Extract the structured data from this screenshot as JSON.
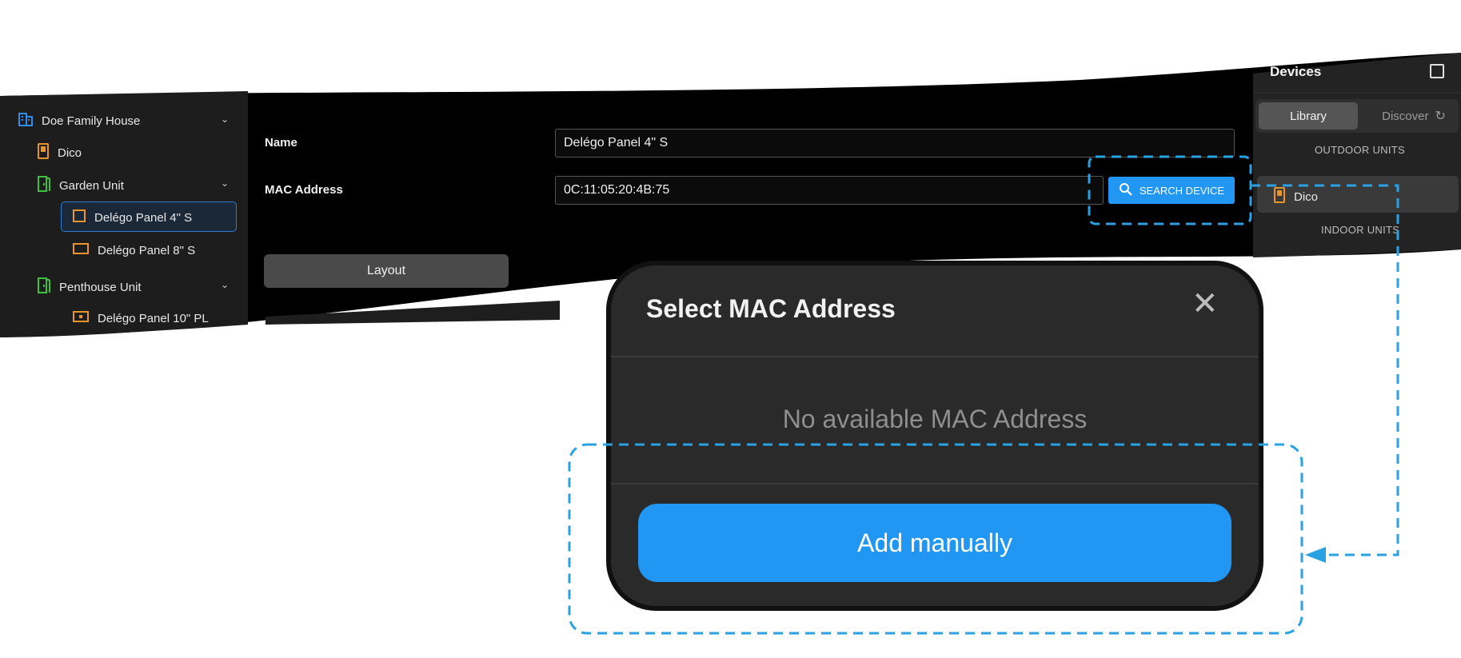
{
  "sidebar": {
    "house": "Doe Family House",
    "items": [
      {
        "label": "Dico"
      },
      {
        "label": "Garden Unit"
      },
      {
        "label": "Delégo Panel 4\" S"
      },
      {
        "label": "Delégo Panel 8\" S"
      },
      {
        "label": "Penthouse Unit"
      },
      {
        "label": "Delégo Panel 10\" PL"
      }
    ]
  },
  "form": {
    "name_label": "Name",
    "name_value": "Delégo Panel 4\" S",
    "mac_label": "MAC Address",
    "mac_value": "0C:11:05:20:4B:75",
    "search_button": "SEARCH DEVICE",
    "layout_tab": "Layout"
  },
  "devices_panel": {
    "title": "Devices",
    "tab_library": "Library",
    "tab_discover": "Discover",
    "outdoor_units": "OUTDOOR UNITS",
    "device_item": "Dico",
    "indoor_units": "INDOOR UNITS"
  },
  "modal": {
    "title": "Select MAC Address",
    "close": "✕",
    "empty_message": "No available MAC Address",
    "add_button": "Add manually"
  },
  "colors": {
    "accent": "#2196f3",
    "highlight_dash": "#2aa1e0",
    "icon_orange": "#e8952b",
    "icon_green": "#3cc23c",
    "icon_blue": "#2f8df0"
  }
}
